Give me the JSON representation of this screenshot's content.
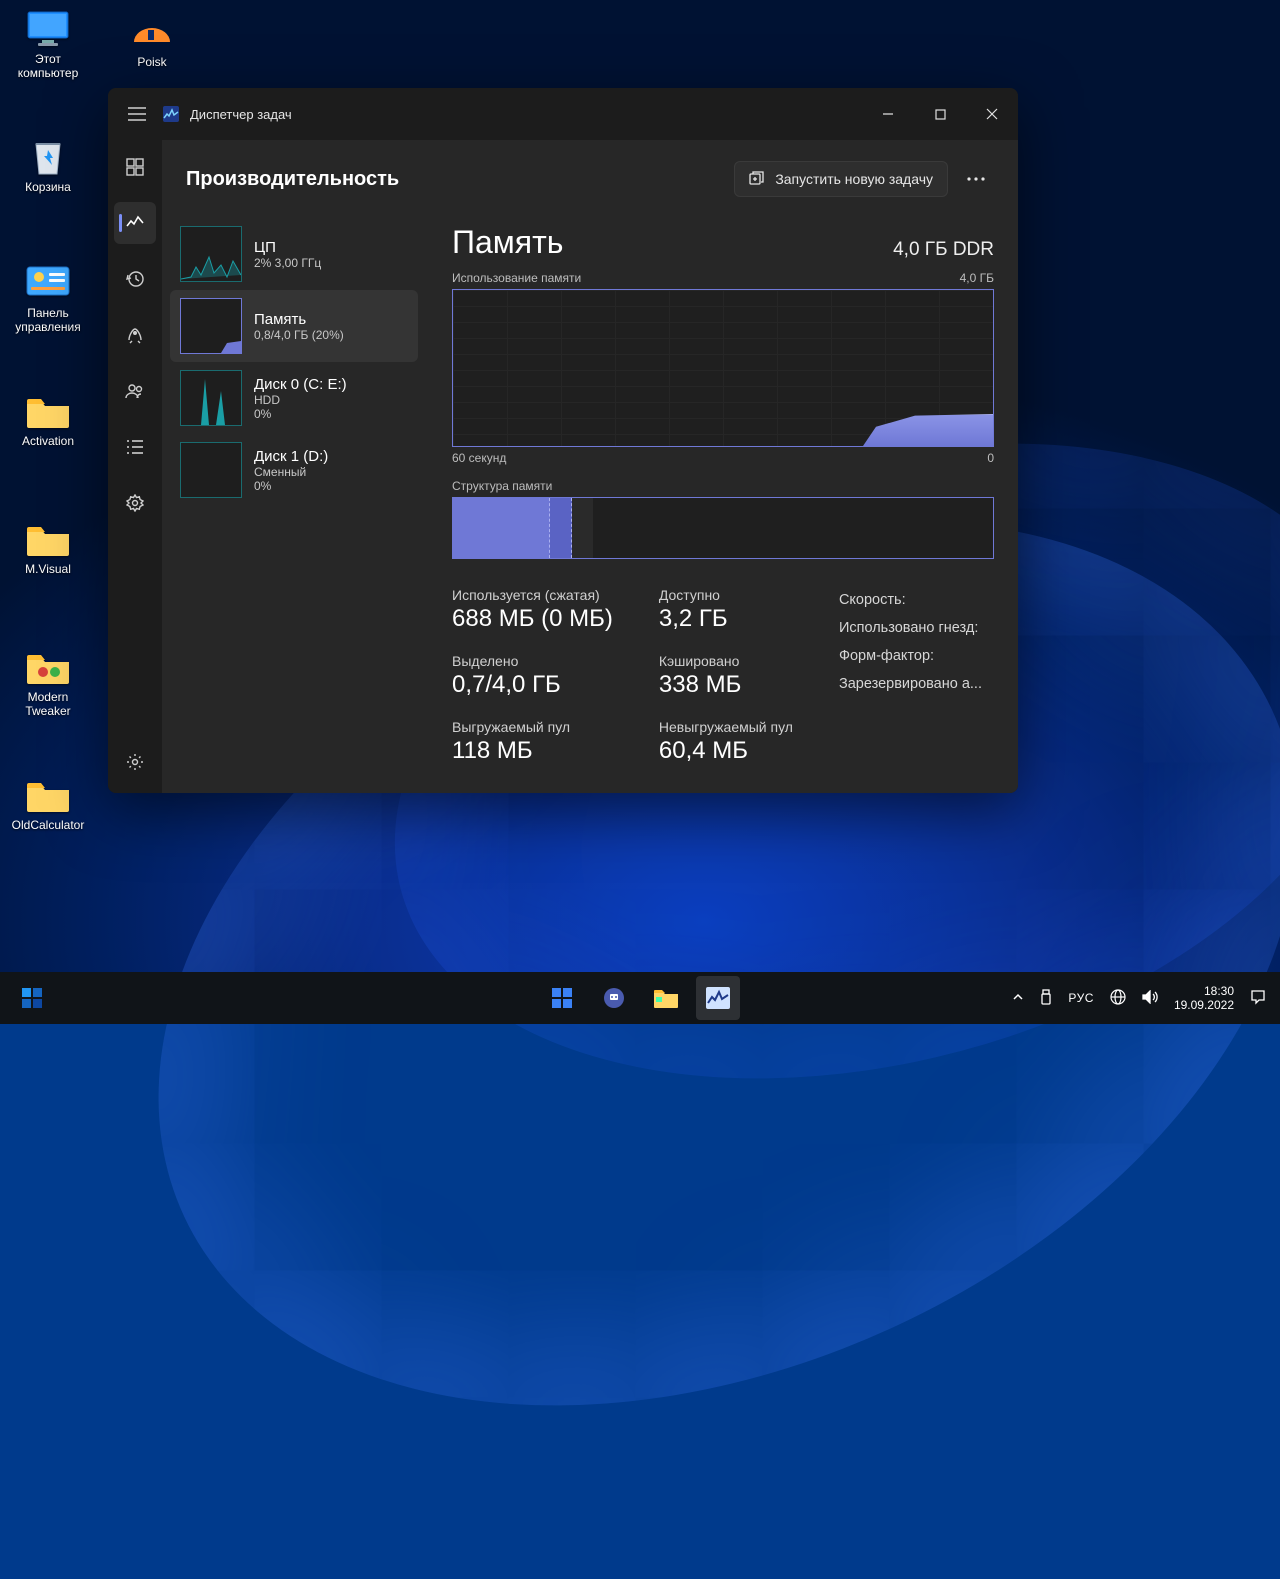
{
  "desktop": {
    "icons_col1": [
      {
        "name": "this-pc",
        "label": "Этот\nкомпьютер",
        "kind": "monitor"
      },
      {
        "name": "recycle-bin",
        "label": "Корзина",
        "kind": "bin"
      },
      {
        "name": "control-panel",
        "label": "Панель\nуправления",
        "kind": "cpanel"
      },
      {
        "name": "activation",
        "label": "Activation",
        "kind": "folder"
      },
      {
        "name": "mvisual",
        "label": "M.Visual",
        "kind": "folder"
      },
      {
        "name": "modern-tweaker",
        "label": "Modern\nTweaker",
        "kind": "folder-red"
      },
      {
        "name": "oldcalculator",
        "label": "OldCalculator",
        "kind": "folder"
      }
    ],
    "icons_col2": [
      {
        "name": "poisk",
        "label": "Poisk",
        "kind": "poisk"
      }
    ]
  },
  "taskmgr": {
    "title": "Диспетчер задач",
    "page_title": "Производительность",
    "run_new_task": "Запустить новую задачу",
    "sidebar": [
      {
        "name": "cpu",
        "title": "ЦП",
        "line1": "2%  3,00 ГГц",
        "color": "#1a9ea5"
      },
      {
        "name": "memory",
        "title": "Память",
        "line1": "0,8/4,0 ГБ (20%)",
        "active": true,
        "color": "#6f78d6"
      },
      {
        "name": "disk0",
        "title": "Диск 0 (C: E:)",
        "line1": "HDD",
        "line2": "0%",
        "color": "#1a9ea5"
      },
      {
        "name": "disk1",
        "title": "Диск 1 (D:)",
        "line1": "Сменный",
        "line2": "0%",
        "color": "#1a9ea5"
      }
    ],
    "detail": {
      "title": "Память",
      "capacity": "4,0 ГБ DDR",
      "graph_label_left": "Использование памяти",
      "graph_label_right": "4,0 ГБ",
      "graph_bottom_left": "60 секунд",
      "graph_bottom_right": "0",
      "composition_label": "Структура памяти",
      "stats_cols": [
        [
          {
            "label": "Используется (сжатая)",
            "value": "688 МБ (0 МБ)"
          },
          {
            "label": "Выделено",
            "value": "0,7/4,0 ГБ"
          },
          {
            "label": "Выгружаемый пул",
            "value": "118 МБ"
          }
        ],
        [
          {
            "label": "Доступно",
            "value": "3,2 ГБ"
          },
          {
            "label": "Кэшировано",
            "value": "338 МБ"
          },
          {
            "label": "Невыгружаемый пул",
            "value": "60,4 МБ"
          }
        ]
      ],
      "props": [
        "Скорость:",
        "Использовано гнезд:",
        "Форм-фактор:",
        "Зарезервировано а..."
      ]
    }
  },
  "taskbar": {
    "lang": "РУС",
    "time": "18:30",
    "date": "19.09.2022"
  },
  "chart_data": {
    "type": "area",
    "title": "Использование памяти",
    "ylabel": "ГБ",
    "ylim": [
      0,
      4.0
    ],
    "xlabel": "секунд",
    "xlim": [
      60,
      0
    ],
    "series": [
      {
        "name": "Память",
        "values_approx_gb": [
          0,
          0,
          0,
          0,
          0,
          0,
          0,
          0,
          0,
          0,
          0,
          0,
          0,
          0,
          0,
          0,
          0,
          0,
          0,
          0,
          0,
          0,
          0,
          0,
          0,
          0,
          0,
          0,
          0,
          0,
          0,
          0,
          0,
          0,
          0,
          0,
          0,
          0,
          0,
          0,
          0,
          0,
          0,
          0,
          0,
          0,
          0,
          0,
          0,
          0,
          0.3,
          0.6,
          0.75,
          0.8,
          0.8,
          0.8,
          0.8,
          0.8,
          0.8,
          0.8
        ]
      }
    ]
  }
}
